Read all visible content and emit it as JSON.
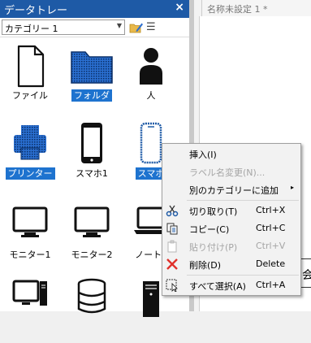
{
  "panel": {
    "title": "データトレー",
    "close_glyph": "×",
    "category_selected": "カテゴリー 1",
    "menu_glyph": "☰"
  },
  "document": {
    "tab_label": "名称未設定 1 *"
  },
  "items": [
    {
      "label": "ファイル",
      "icon": "file-icon",
      "selected": false
    },
    {
      "label": "フォルダ",
      "icon": "folder-icon",
      "selected": true
    },
    {
      "label": "人",
      "icon": "person-icon",
      "selected": false
    },
    {
      "label": "プリンター",
      "icon": "printer-icon",
      "selected": true
    },
    {
      "label": "スマホ1",
      "icon": "smartphone-icon",
      "selected": false
    },
    {
      "label": "スマホ",
      "icon": "smartphone-outline-icon",
      "selected": true
    },
    {
      "label": "モニター1",
      "icon": "monitor-icon",
      "selected": false
    },
    {
      "label": "モニター2",
      "icon": "monitor-icon",
      "selected": false
    },
    {
      "label": "ノートP",
      "icon": "laptop-icon",
      "selected": false
    },
    {
      "label": "",
      "icon": "desktop-pc-icon",
      "selected": false
    },
    {
      "label": "",
      "icon": "database-icon",
      "selected": false
    },
    {
      "label": "",
      "icon": "server-icon",
      "selected": false
    }
  ],
  "context_menu": {
    "insert": "挿入(I)",
    "rename_label": "ラベル名変更(N)...",
    "add_to_category": "別のカテゴリーに追加",
    "cut": "切り取り(T)",
    "cut_shortcut": "Ctrl+X",
    "copy": "コピー(C)",
    "copy_shortcut": "Ctrl+C",
    "paste": "貼り付け(P)",
    "paste_shortcut": "Ctrl+V",
    "delete": "削除(D)",
    "delete_shortcut": "Delete",
    "select_all": "すべて選択(A)",
    "select_all_shortcut": "Ctrl+A",
    "submenu_glyph": "▸"
  },
  "canvas_fragment": "会"
}
